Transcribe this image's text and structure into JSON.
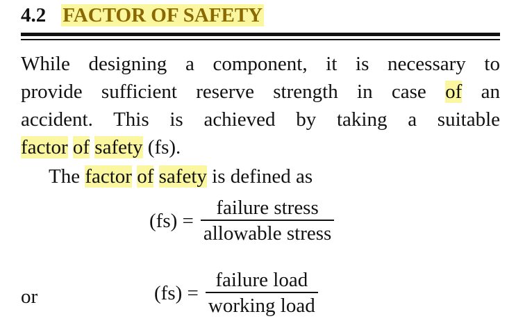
{
  "section": {
    "number": "4.2",
    "title": "FACTOR OF SAFETY"
  },
  "paragraph": {
    "line1": "While designing a component, it is necessary to",
    "line2_part1": "provide sufficient reserve strength in case ",
    "line2_hl": "of",
    "line2_part2": " an",
    "line3": "accident. This is achieved by taking a suitable",
    "line4_hl1": "factor",
    "line4_sp1": " ",
    "line4_hl2": "of",
    "line4_sp2": " ",
    "line4_hl3": "safety",
    "line4_end": " (fs)."
  },
  "definition": {
    "prefix": "The ",
    "hl1": "factor",
    "sp1": " ",
    "hl2": "of",
    "sp2": " ",
    "hl3": "safety",
    "suffix": " is defined as"
  },
  "equation1": {
    "lhs": "(fs) =",
    "numerator": "failure stress",
    "denominator": "allowable stress"
  },
  "equation2": {
    "or_label": "or",
    "lhs": "(fs) =",
    "numerator": "failure load",
    "denominator": "working load"
  }
}
